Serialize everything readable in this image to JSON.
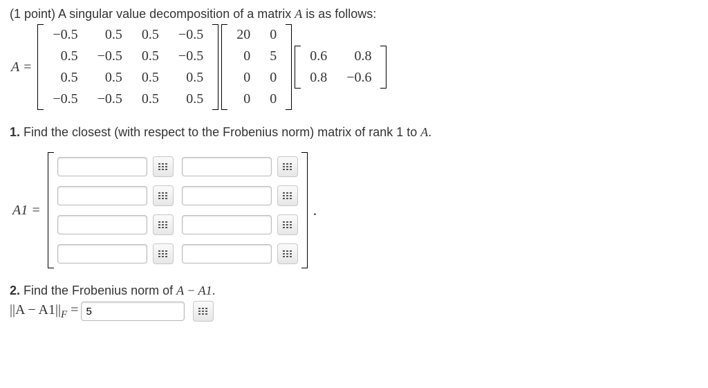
{
  "header": {
    "points": "(1 point)",
    "intro1": " A singular value decomposition of a matrix ",
    "matVar": "A",
    "intro2": " is as follows:"
  },
  "svd": {
    "lhs": "A =",
    "U": [
      [
        "−0.5",
        "0.5",
        "0.5",
        "−0.5"
      ],
      [
        "0.5",
        "−0.5",
        "0.5",
        "−0.5"
      ],
      [
        "0.5",
        "0.5",
        "0.5",
        "0.5"
      ],
      [
        "−0.5",
        "−0.5",
        "0.5",
        "0.5"
      ]
    ],
    "S": [
      [
        "20",
        "0"
      ],
      [
        "0",
        "5"
      ],
      [
        "0",
        "0"
      ],
      [
        "0",
        "0"
      ]
    ],
    "V": [
      [
        "0.6",
        "0.8"
      ],
      [
        "0.8",
        "−0.6"
      ]
    ]
  },
  "q1": {
    "num": "1.",
    "text1": " Find the closest (with respect to the Frobenius norm) matrix of rank 1 to ",
    "var": "A",
    "text2": ".",
    "lhs": "A1 =",
    "trail": "."
  },
  "q2": {
    "num": "2.",
    "text1": " Find the Frobenius norm of ",
    "expr": "A − A1",
    "text2": ".",
    "lhsNorm": "||A − A1||",
    "lhsSub": "F",
    "eq": " = ",
    "value": "5"
  }
}
